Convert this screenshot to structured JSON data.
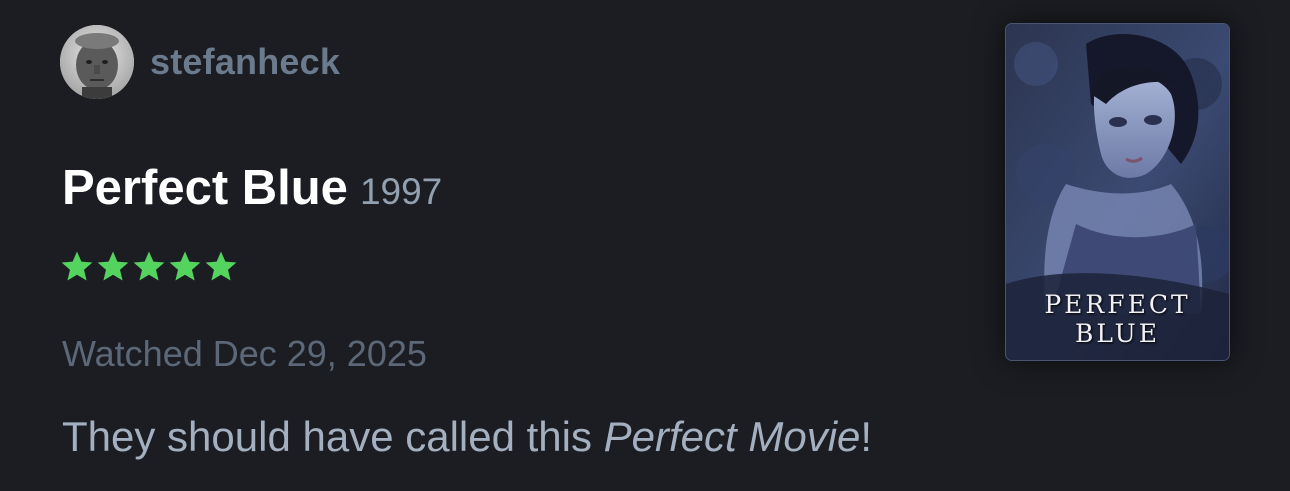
{
  "user": {
    "username": "stefanheck"
  },
  "film": {
    "title": "Perfect Blue",
    "year": "1997",
    "rating_stars": 5,
    "rating_max": 5,
    "star_color": "#54d35f",
    "poster_title": "PERFECT BLUE"
  },
  "watched": {
    "text": "Watched Dec 29, 2025"
  },
  "review": {
    "before": "They should have called this ",
    "emphasis": "Perfect Movie",
    "after": "!"
  }
}
